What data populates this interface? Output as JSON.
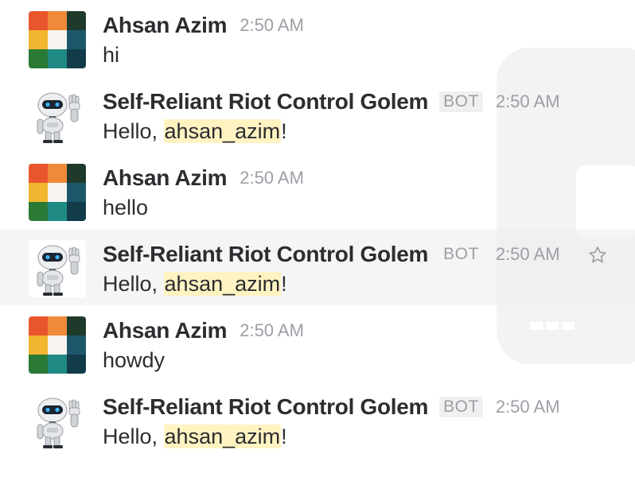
{
  "colors": {
    "mention_bg": "#fff3c2",
    "timestamp": "#9e9ea6",
    "sender_text": "#2c2d30",
    "hover_row": "#f4f4f5"
  },
  "messages": [
    {
      "sender": "Ahsan Azim",
      "time": "2:50 AM",
      "avatar": "identicon-avatar",
      "text": "hi"
    },
    {
      "sender": "Self-Reliant Riot Control Golem",
      "badge": "BOT",
      "time": "2:50 AM",
      "avatar": "robot-avatar",
      "text_prefix": "Hello, ",
      "mention": "ahsan_azim",
      "text_suffix": "!"
    },
    {
      "sender": "Ahsan Azim",
      "time": "2:50 AM",
      "avatar": "identicon-avatar",
      "text": "hello"
    },
    {
      "sender": "Self-Reliant Riot Control Golem",
      "badge": "BOT",
      "time": "2:50 AM",
      "avatar": "robot-avatar",
      "text_prefix": "Hello, ",
      "mention": "ahsan_azim",
      "text_suffix": "!",
      "action_icon": "star-icon"
    },
    {
      "sender": "Ahsan Azim",
      "time": "2:50 AM",
      "avatar": "identicon-avatar",
      "text": "howdy"
    },
    {
      "sender": "Self-Reliant Riot Control Golem",
      "badge": "BOT",
      "time": "2:50 AM",
      "avatar": "robot-avatar",
      "text_prefix": "Hello, ",
      "mention": "ahsan_azim",
      "text_suffix": "!"
    }
  ]
}
